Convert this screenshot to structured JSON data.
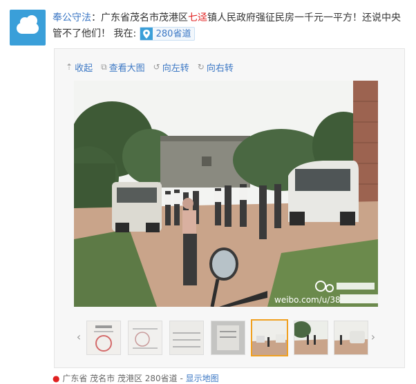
{
  "post": {
    "author": "奉公守法",
    "sep": "：",
    "text_before": "广东省茂名市茂港区",
    "highlight": "七迳",
    "text_after": "镇人民政府强征民房一千元一平方！还说中央管不了他们！ 我在:",
    "location_tag": "280省道"
  },
  "toolbar": {
    "collapse": "收起",
    "view_large": "查看大图",
    "rotate_left": "向左转",
    "rotate_right": "向右转"
  },
  "photo": {
    "watermark": "weibo.com/u/38"
  },
  "thumbnails": {
    "count": 7,
    "selected_index": 4
  },
  "bottom_location": {
    "text": "广东省 茂名市 茂港区 280省道 -",
    "link": "显示地图"
  },
  "colors": {
    "link": "#3b77c4",
    "highlight": "#e02020",
    "selected_border": "#f0a020"
  }
}
